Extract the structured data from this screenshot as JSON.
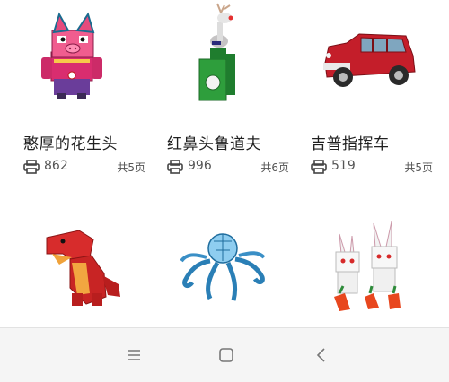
{
  "models": [
    {
      "title": "憨厚的花生头",
      "count": "862",
      "pages": "共5页",
      "image": "pink-pig-box-papercraft"
    },
    {
      "title": "红鼻头鲁道夫",
      "count": "996",
      "pages": "共6页",
      "image": "reindeer-on-green-box-papercraft"
    },
    {
      "title": "吉普指挥车",
      "count": "519",
      "pages": "共5页",
      "image": "red-jeep-papercraft"
    },
    {
      "title": "",
      "count": "",
      "pages": "",
      "image": "red-dinosaur-papercraft"
    },
    {
      "title": "",
      "count": "",
      "pages": "",
      "image": "blue-octopus-papercraft"
    },
    {
      "title": "",
      "count": "",
      "pages": "",
      "image": "white-rabbits-with-carrots-papercraft"
    }
  ],
  "icons": {
    "print": "printer-icon",
    "menu": "menu-icon",
    "home": "home-icon",
    "back": "back-icon"
  },
  "colors": {
    "nav_bg": "#f5f5f5",
    "title_text": "#202020",
    "meta_text": "#555555"
  }
}
